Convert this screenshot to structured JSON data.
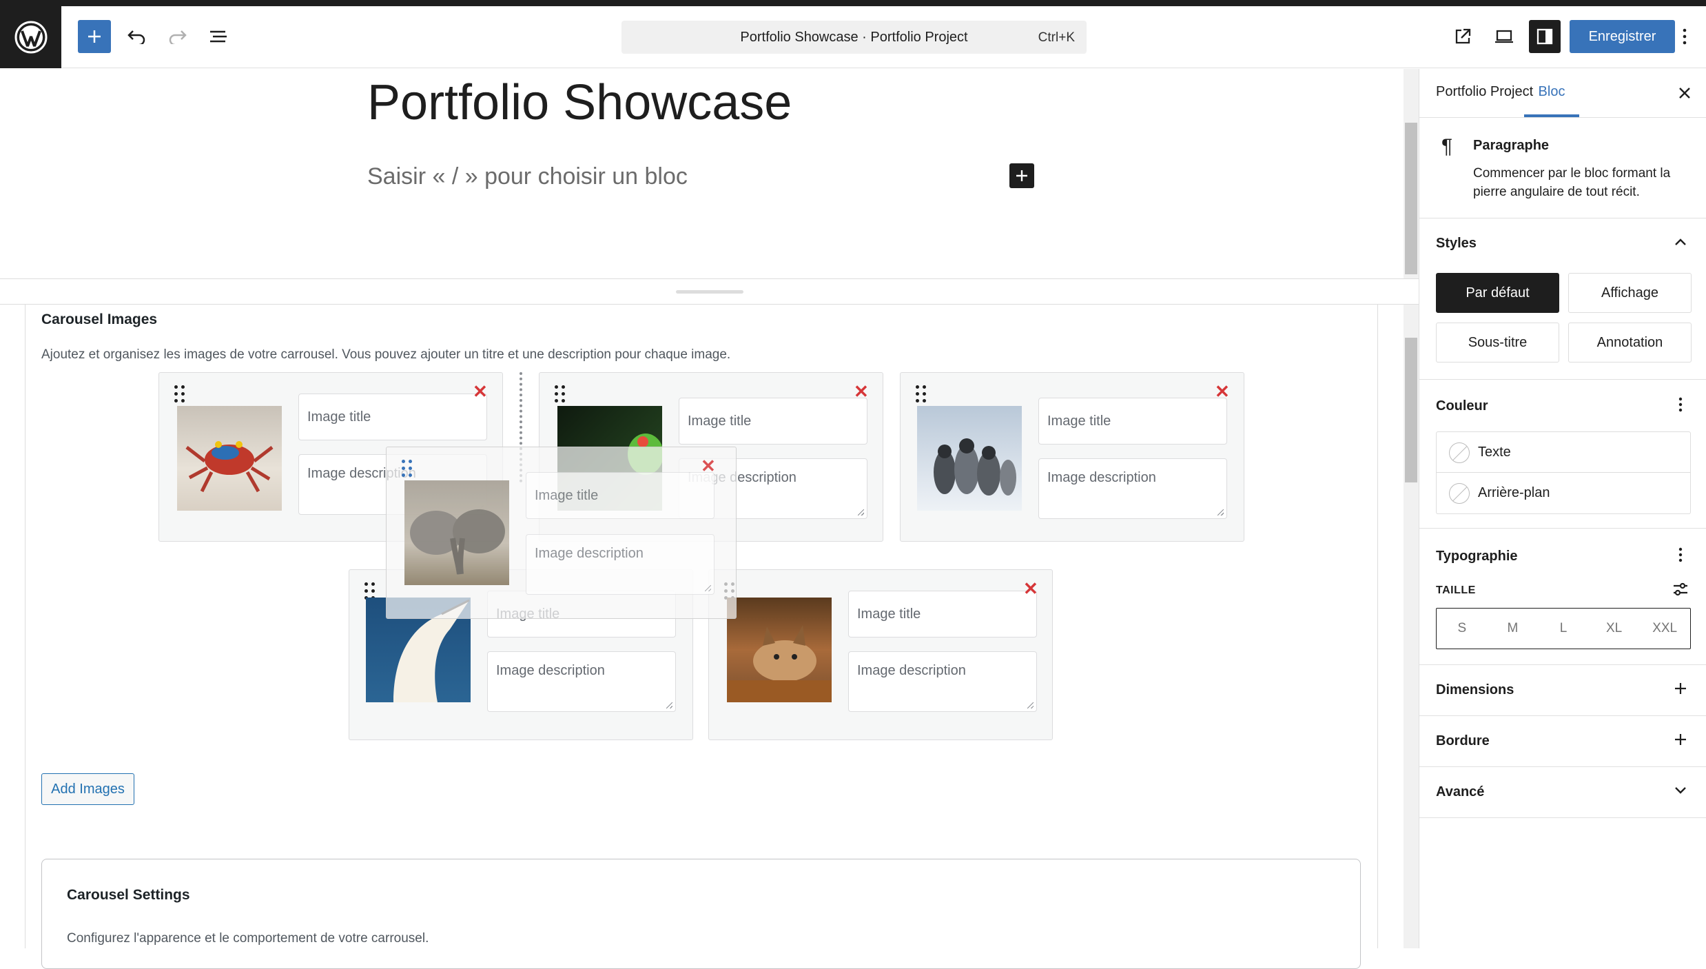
{
  "toolbar": {
    "command_bar_title": "Portfolio Showcase · Portfolio Project",
    "command_bar_shortcut": "Ctrl+K",
    "save_label": "Enregistrer",
    "accent": "#3873b9"
  },
  "editor": {
    "post_title": "Portfolio Showcase",
    "block_placeholder": "Saisir « / » pour choisir un bloc"
  },
  "carousel": {
    "heading": "Carousel Images",
    "help": "Ajoutez et organisez les images de votre carrousel. Vous pouvez ajouter un titre et une description pour chaque image.",
    "title_placeholder": "Image title",
    "description_placeholder": "Image description",
    "add_images_label": "Add Images",
    "items": [
      {
        "image": "crab"
      },
      {
        "image": "frog"
      },
      {
        "image": "penguins"
      },
      {
        "image": "gannet"
      },
      {
        "image": "lynx"
      }
    ],
    "dragging_item": {
      "image": "elephants"
    }
  },
  "carousel_settings": {
    "heading": "Carousel Settings",
    "help": "Configurez l'apparence et le comportement de votre carrousel."
  },
  "sidebar": {
    "tabs": [
      "Portfolio Project",
      "Bloc"
    ],
    "active_tab": "Bloc",
    "block_name": "Paragraphe",
    "block_description": "Commencer par le bloc formant la pierre angulaire de tout récit.",
    "styles_heading": "Styles",
    "styles": [
      "Par défaut",
      "Affichage",
      "Sous-titre",
      "Annotation"
    ],
    "active_style": "Par défaut",
    "color_heading": "Couleur",
    "color_options": [
      "Texte",
      "Arrière-plan"
    ],
    "typography_heading": "Typographie",
    "size_label": "TAILLE",
    "sizes": [
      "S",
      "M",
      "L",
      "XL",
      "XXL"
    ],
    "dimensions_heading": "Dimensions",
    "border_heading": "Bordure",
    "advanced_heading": "Avancé"
  }
}
